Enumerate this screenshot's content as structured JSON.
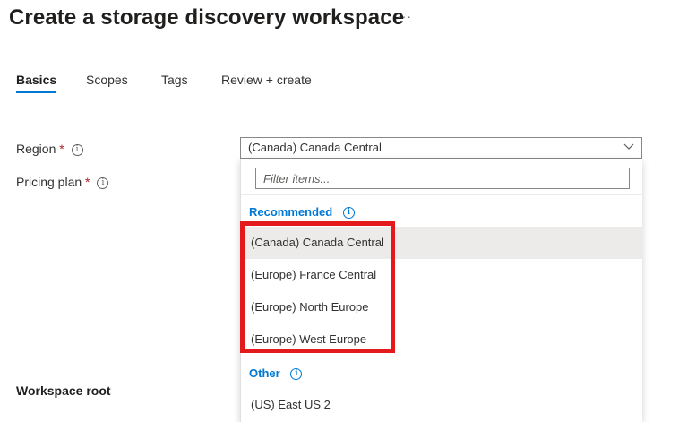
{
  "page": {
    "title": "Create a storage discovery workspace",
    "more_label": "···"
  },
  "tabs": [
    {
      "label": "Basics",
      "active": true
    },
    {
      "label": "Scopes",
      "active": false
    },
    {
      "label": "Tags",
      "active": false
    },
    {
      "label": "Review + create",
      "active": false
    }
  ],
  "form": {
    "region_label": "Region",
    "pricing_label": "Pricing plan",
    "required_mark": "*",
    "section_workspace_root": "Workspace root"
  },
  "region_select": {
    "value": "(Canada) Canada Central",
    "filter_placeholder": "Filter items...",
    "groups": [
      {
        "label": "Recommended",
        "options": [
          "(Canada) Canada Central",
          "(Europe) France Central",
          "(Europe) North Europe",
          "(Europe) West Europe"
        ]
      },
      {
        "label": "Other",
        "options": [
          "(US) East US 2"
        ]
      }
    ]
  },
  "icons": {
    "info": "info-icon",
    "chevron": "chevron-down-icon",
    "info_glyph": "i"
  },
  "colors": {
    "accent": "#0078d4",
    "highlight": "#e3191b",
    "required": "#a4262c",
    "selected_bg": "#edebe9"
  }
}
